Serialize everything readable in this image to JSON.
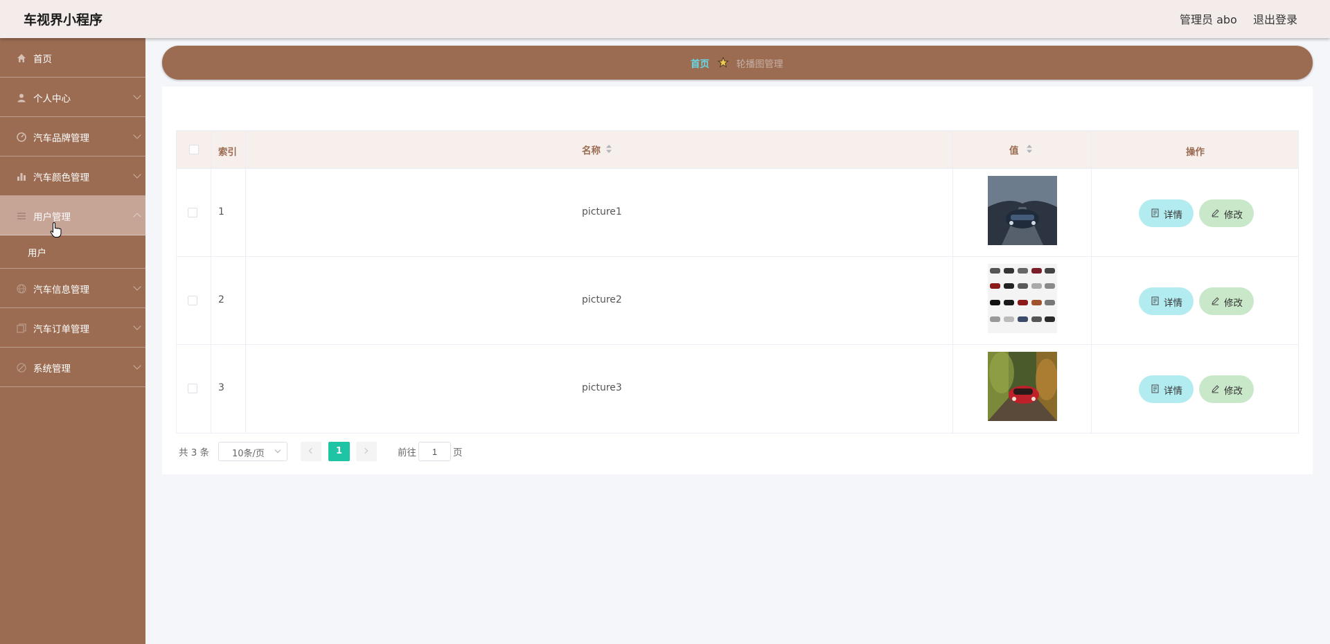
{
  "header": {
    "app_title": "车视界小程序",
    "user_label": "管理员 abo",
    "logout_label": "退出登录"
  },
  "sidebar": {
    "items": [
      {
        "label": "首页",
        "icon": "home-icon"
      },
      {
        "label": "个人中心",
        "icon": "user-icon"
      },
      {
        "label": "汽车品牌管理",
        "icon": "gauge-icon"
      },
      {
        "label": "汽车颜色管理",
        "icon": "bar-chart-icon"
      },
      {
        "label": "用户管理",
        "icon": "list-icon",
        "expanded": true
      },
      {
        "label": "汽车信息管理",
        "icon": "globe-icon"
      },
      {
        "label": "汽车订单管理",
        "icon": "copy-icon"
      },
      {
        "label": "系统管理",
        "icon": "compass-icon"
      }
    ],
    "submenu": {
      "label": "用户"
    }
  },
  "breadcrumb": {
    "home": "首页",
    "current": "轮播图管理"
  },
  "table": {
    "headers": {
      "index": "索引",
      "name": "名称",
      "value": "值",
      "actions": "操作"
    },
    "rows": [
      {
        "index": "1",
        "name": "picture1",
        "image": "dark-car-road-photo"
      },
      {
        "index": "2",
        "name": "picture2",
        "image": "car-grid-catalog-photo"
      },
      {
        "index": "3",
        "name": "picture3",
        "image": "red-car-forest-photo"
      }
    ],
    "detail_label": "详情",
    "edit_label": "修改"
  },
  "pagination": {
    "total": "共 3 条",
    "page_size": "10条/页",
    "current_page": "1",
    "goto_label": "前往",
    "goto_value": "1",
    "page_unit": "页"
  },
  "colors": {
    "sidebar_bg": "#9b6c52",
    "header_bg": "#f3ecea",
    "accent_page": "#1ec4a4",
    "detail_btn": "#b3ecf0",
    "edit_btn": "#c9e8c9"
  }
}
